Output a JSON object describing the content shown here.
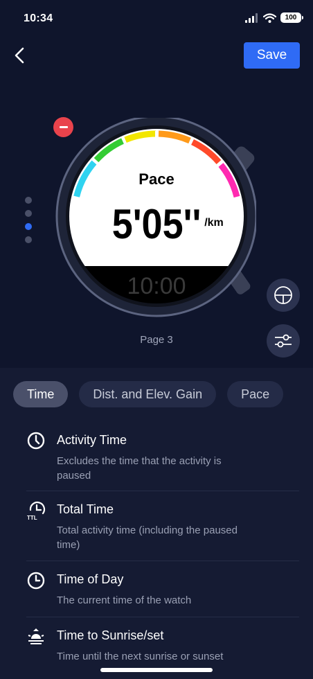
{
  "status": {
    "time": "10:34",
    "battery": "100"
  },
  "header": {
    "save_label": "Save"
  },
  "watch": {
    "title": "Pace",
    "value": "5'05''",
    "unit": "/km",
    "bottom_value": "10:00",
    "page_label": "Page 3"
  },
  "pager": {
    "total": 4,
    "current": 3
  },
  "tabs": [
    {
      "label": "Time",
      "active": true
    },
    {
      "label": "Dist. and Elev. Gain",
      "active": false
    },
    {
      "label": "Pace",
      "active": false
    }
  ],
  "items": [
    {
      "icon": "clock-icon",
      "title": "Activity Time",
      "desc": "Excludes the time that the activity is paused"
    },
    {
      "icon": "total-time-icon",
      "title": "Total Time",
      "desc": "Total activity time (including the paused time)"
    },
    {
      "icon": "clock-icon",
      "title": "Time of Day",
      "desc": "The current time of the watch"
    },
    {
      "icon": "sunrise-icon",
      "title": "Time to Sunrise/set",
      "desc": "Time until the next sunrise or sunset"
    }
  ],
  "colors": {
    "accent": "#2f6bf5",
    "remove": "#e9434c",
    "background": "#151b33",
    "header_bg": "#0f152c"
  }
}
